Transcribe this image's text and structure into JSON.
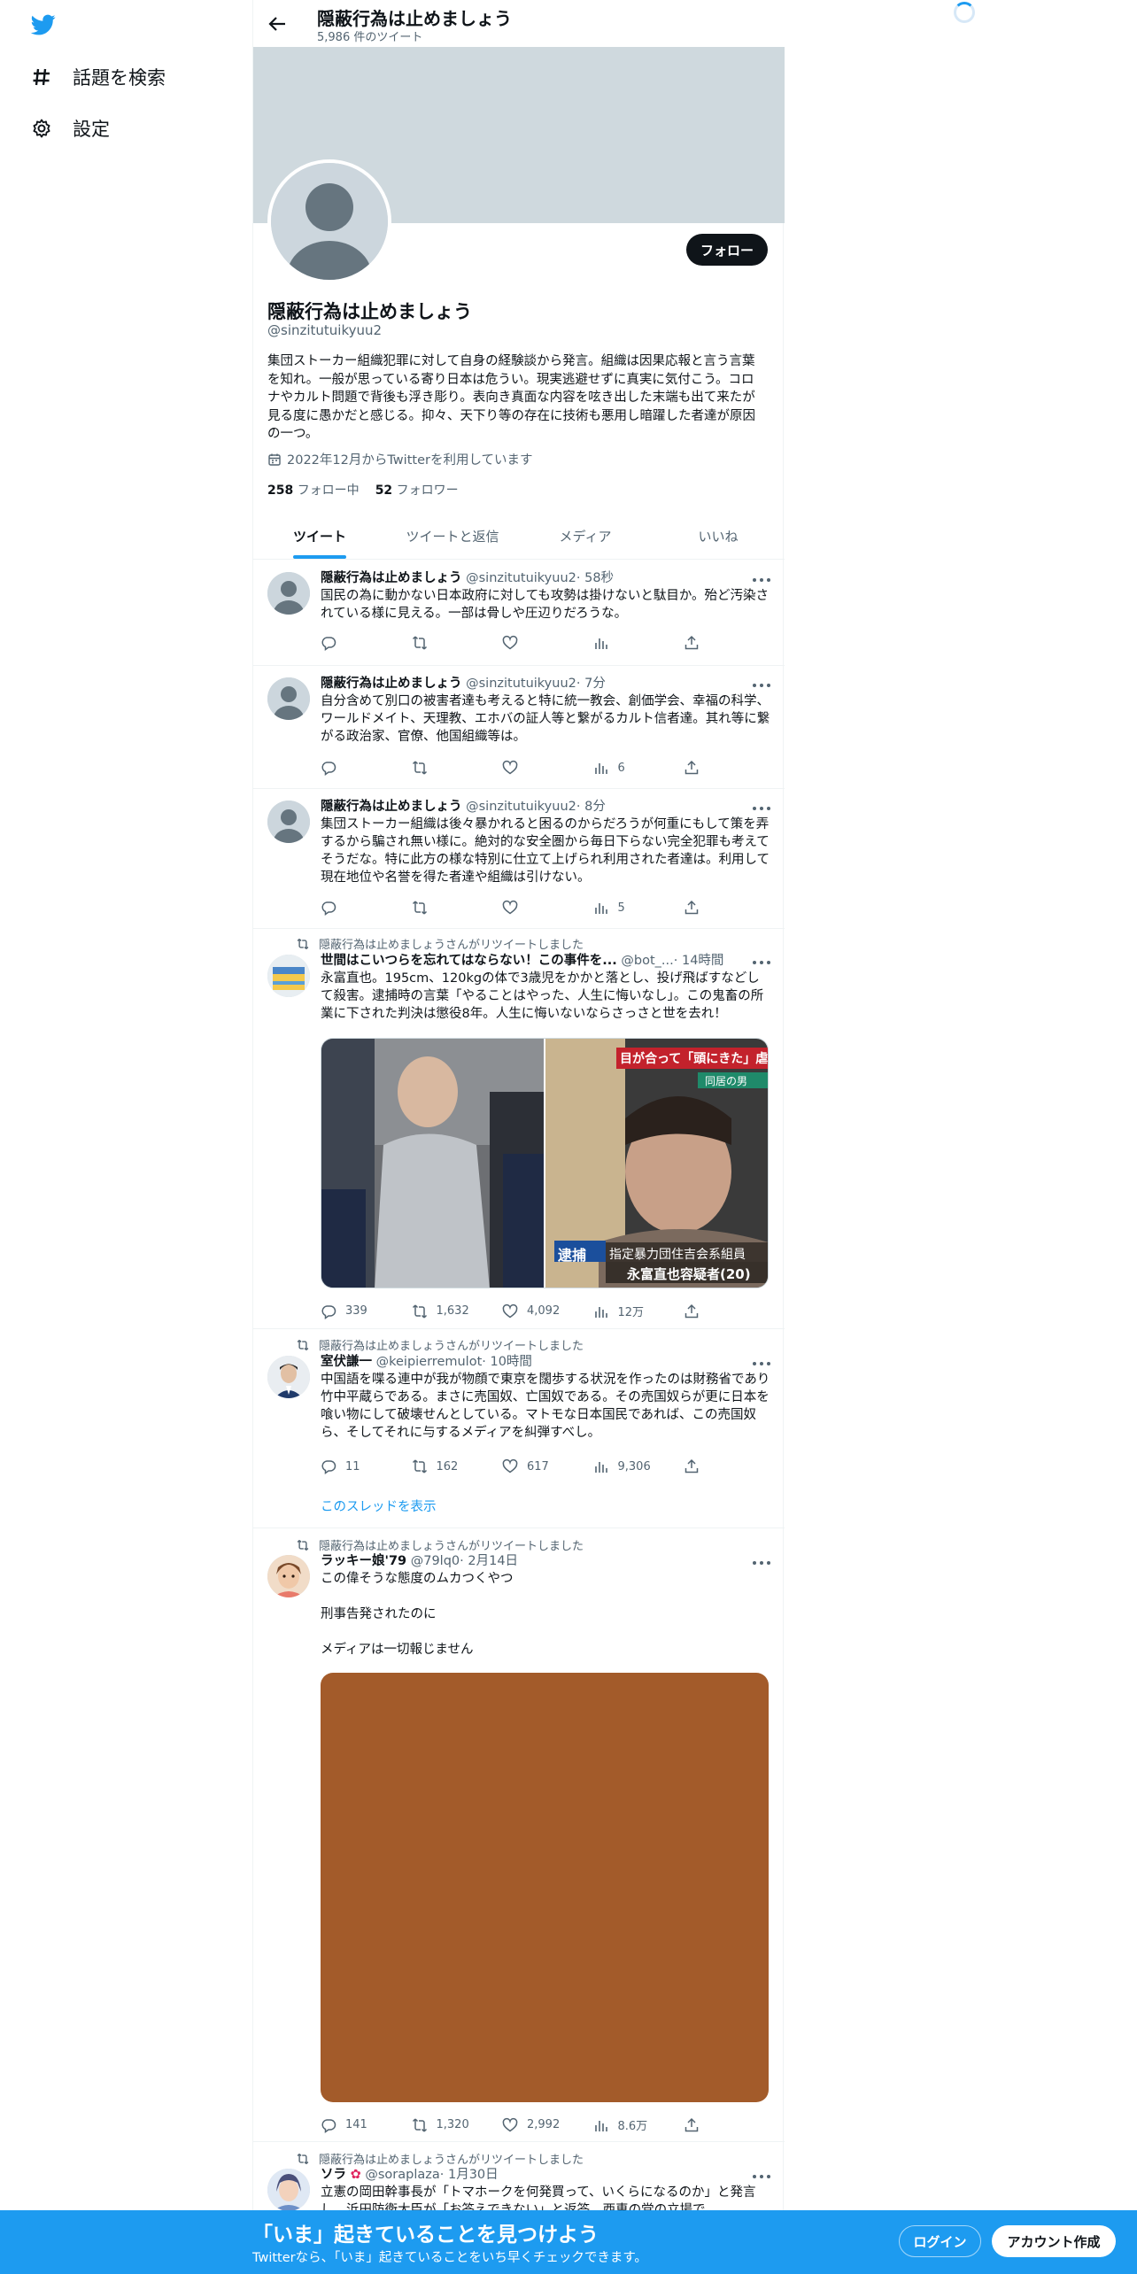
{
  "nav": {
    "explore_label": "話題を検索",
    "settings_label": "設定"
  },
  "header": {
    "title": "隠蔽行為は止めましょう",
    "tweet_count": "5,986 件のツイート"
  },
  "profile": {
    "name": "隠蔽行為は止めましょう",
    "handle": "@sinzitutuikyuu2",
    "follow_label": "フォロー",
    "bio": "集団ストーカー組織犯罪に対して自身の経験談から発言。組織は因果応報と言う言葉を知れ。一般が思っている寄り日本は危うい。現実逃避せずに真実に気付こう。コロナやカルト問題で背後も浮き彫り。表向き真面な内容を呟き出した末端も出て来たが見る度に愚かだと感じる。抑々、天下り等の存在に技術も悪用し暗躍した者達が原因の一つ。",
    "joined": "2022年12月からTwitterを利用しています",
    "following_count": "258",
    "following_label": "フォロー中",
    "followers_count": "52",
    "followers_label": "フォロワー"
  },
  "tabs": [
    {
      "label": "ツイート",
      "active": true
    },
    {
      "label": "ツイートと返信",
      "active": false
    },
    {
      "label": "メディア",
      "active": false
    },
    {
      "label": "いいね",
      "active": false
    }
  ],
  "tweets": [
    {
      "name": "隠蔽行為は止めましょう",
      "handle": "@sinzitutuikyuu2",
      "time": "· 58秒",
      "text": "国民の為に動かない日本政府に対しても攻勢は掛けないと駄目か。殆ど汚染されている様に見える。一部は骨しや圧辺りだろうな。",
      "views": ""
    },
    {
      "name": "隠蔽行為は止めましょう",
      "handle": "@sinzitutuikyuu2",
      "time": "· 7分",
      "text": "自分含めて別口の被害者達も考えると特に統一教会、創価学会、幸福の科学、ワールドメイト、天理教、エホバの証人等と繋がるカルト信者達。其れ等に繋がる政治家、官僚、他国組織等は。",
      "views": "6"
    },
    {
      "name": "隠蔽行為は止めましょう",
      "handle": "@sinzitutuikyuu2",
      "time": "· 8分",
      "text": "集団ストーカー組織は後々暴かれると困るのからだろうが何重にもして策を弄するから騙され無い様に。絶対的な安全圏から毎日下らない完全犯罪も考えてそうだな。特に此方の様な特別に仕立て上げられ利用された者達は。利用して現在地位や名誉を得た者達や組織は引けない。",
      "views": "5"
    },
    {
      "retweet_label": "隠蔽行為は止めましょうさんがリツイートしました",
      "name": "世間はこいつらを忘れてはならない！この事件を...",
      "handle": "@bot_...",
      "time": "· 14時間",
      "text": "永富直也。195cm、120kgの体で3歳児をかかと落とし、投げ飛ばすなどして殺害。逮捕時の言葉「やることはやった、人生に悔いなし」。この鬼畜の所業に下された判決は懲役8年。人生に悔いないならさっさと世を去れ！",
      "media_caption_top": "目が合って「頭にきた」虐待か",
      "media_caption_tag": "同居の男",
      "media_caption_arrest": "逮捕",
      "media_caption_group": "指定暴力団住吉会系組員",
      "media_caption_name": "永富直也容疑者(20)",
      "replies": "339",
      "retweets": "1,632",
      "likes": "4,092",
      "views": "12万"
    },
    {
      "retweet_label": "隠蔽行為は止めましょうさんがリツイートしました",
      "name": "室伏謙一",
      "handle": "@keipierremulot",
      "time": "· 10時間",
      "text": "中国語を喋る連中が我が物顔で東京を闊歩する状況を作ったのは財務省であり竹中平蔵らである。まさに売国奴、亡国奴である。その売国奴らが更に日本を喰い物にして破壊せんとしている。マトモな日本国民であれば、この売国奴ら、そしてそれに与するメディアを糾弾すべし。",
      "replies": "11",
      "retweets": "162",
      "likes": "617",
      "views": "9,306",
      "thread_label": "このスレッドを表示"
    },
    {
      "retweet_label": "隠蔽行為は止めましょうさんがリツイートしました",
      "name": "ラッキー娘'79",
      "handle": "@79lq0",
      "time": "· 2月14日",
      "line1": "この偉そうな態度のムカつくやつ",
      "line2": "刑事告発されたのに",
      "line3": "メディアは一切報じません",
      "replies": "141",
      "retweets": "1,320",
      "likes": "2,992",
      "views": "8.6万"
    },
    {
      "retweet_label": "隠蔽行為は止めましょうさんがリツイートしました",
      "name": "ソラ",
      "handle": "@soraplaza",
      "time": "· 1月30日",
      "text": "立憲の岡田幹事長が「トマホークを何発買って、いくらになるのか」と発言し、浜田防衛大臣が「お答えできない」と返答。西恵の党の立場で..."
    }
  ],
  "bottom_bar": {
    "title": "「いま」起きていることを見つけよう",
    "subtitle": "Twitterなら、「いま」起きていることをいち早くチェックできます。",
    "login_label": "ログイン",
    "signup_label": "アカウント作成"
  }
}
